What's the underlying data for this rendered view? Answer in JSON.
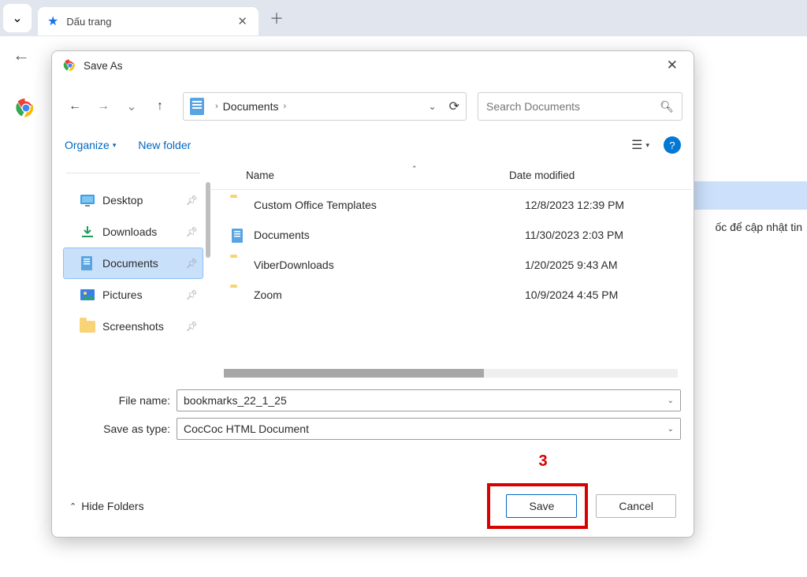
{
  "browser": {
    "tab_title": "Dấu trang",
    "background_band_text": "ốc để cập nhật tin"
  },
  "dialog": {
    "title": "Save As",
    "path_segment": "Documents",
    "search_placeholder": "Search Documents",
    "organize_label": "Organize",
    "newfolder_label": "New folder",
    "columns": {
      "name": "Name",
      "date": "Date modified"
    },
    "sidebar": [
      {
        "label": "Desktop",
        "icon": "desktop"
      },
      {
        "label": "Downloads",
        "icon": "downloads"
      },
      {
        "label": "Documents",
        "icon": "documents",
        "selected": true
      },
      {
        "label": "Pictures",
        "icon": "pictures"
      },
      {
        "label": "Screenshots",
        "icon": "folder"
      }
    ],
    "files": [
      {
        "name": "Custom Office Templates",
        "date": "12/8/2023 12:39 PM",
        "type": "folder"
      },
      {
        "name": "Documents",
        "date": "11/30/2023 2:03 PM",
        "type": "docfolder"
      },
      {
        "name": "ViberDownloads",
        "date": "1/20/2025 9:43 AM",
        "type": "folder"
      },
      {
        "name": "Zoom",
        "date": "10/9/2024 4:45 PM",
        "type": "folder"
      }
    ],
    "file_name_label": "File name:",
    "file_name_value": "bookmarks_22_1_25",
    "save_type_label": "Save as type:",
    "save_type_value": "CocCoc HTML Document",
    "hide_folders_label": "Hide Folders",
    "save_label": "Save",
    "cancel_label": "Cancel"
  },
  "annotation": {
    "step": "3"
  }
}
